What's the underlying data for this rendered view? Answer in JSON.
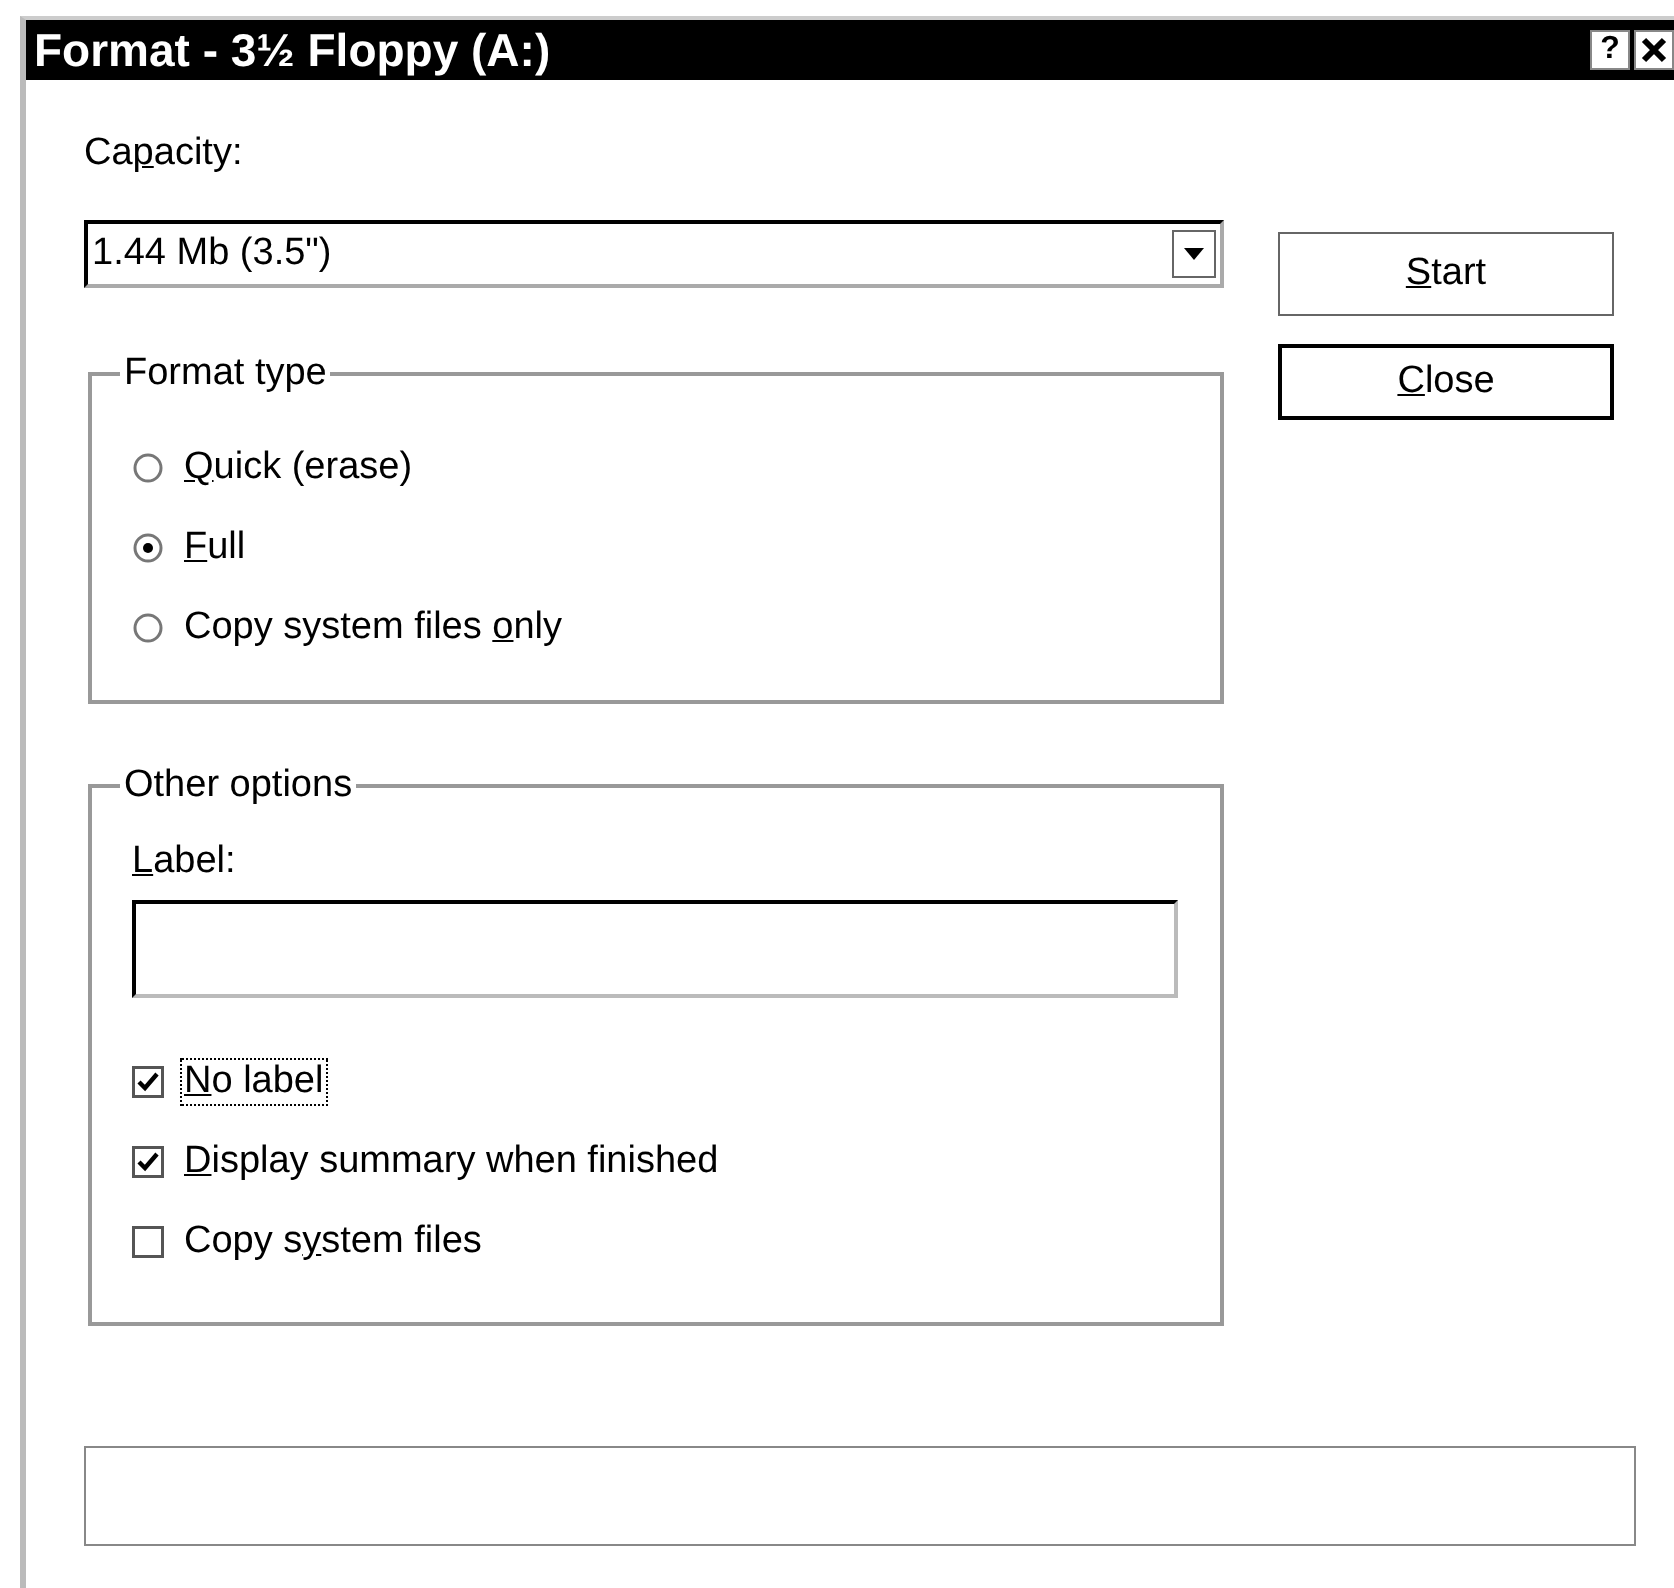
{
  "window": {
    "title": "Format - 3½ Floppy (A:)",
    "help_button": "?"
  },
  "capacity": {
    "label": {
      "before": "Ca",
      "key": "p",
      "after": "acity:"
    },
    "value": "1.44 Mb (3.5\")"
  },
  "buttons": [
    {
      "label": {
        "key": "S",
        "after": "tart"
      }
    },
    {
      "label": {
        "key": "C",
        "after": "lose"
      }
    }
  ],
  "format_type": {
    "title": "Format type",
    "options": [
      {
        "label": {
          "key": "Q",
          "after": "uick (erase)"
        },
        "selected": false
      },
      {
        "label": {
          "key": "F",
          "after": "ull"
        },
        "selected": true
      },
      {
        "label": {
          "before": "Copy system files ",
          "key": "o",
          "after": "nly"
        },
        "selected": false
      }
    ]
  },
  "other_options": {
    "title": "Other options",
    "label_field": {
      "label": {
        "key": "L",
        "after": "abel:"
      }
    },
    "options": [
      {
        "label": {
          "key": "N",
          "after": "o label"
        },
        "checked": true,
        "focused": true
      },
      {
        "label": {
          "key": "D",
          "after": "isplay summary when finished"
        },
        "checked": true,
        "focused": false
      },
      {
        "label": {
          "before": "Copy s",
          "key": "y",
          "after": "stem files"
        },
        "checked": false,
        "focused": false
      }
    ]
  }
}
